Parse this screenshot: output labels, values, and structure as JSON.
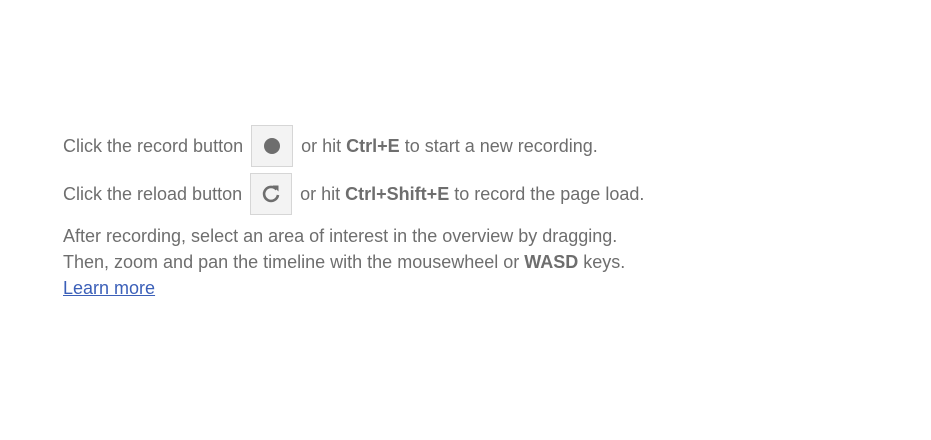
{
  "record_row": {
    "prefix": "Click the record button",
    "middle": "or hit",
    "key_1": "Ctrl",
    "plus_1": "+",
    "key_2": "E",
    "suffix": "to start a new recording.",
    "button_icon": "record-dot-icon"
  },
  "reload_row": {
    "prefix": "Click the reload button",
    "middle": "or hit",
    "key_1": "Ctrl",
    "plus_1": "+",
    "key_2": "Shift",
    "plus_2": "+",
    "key_3": "E",
    "suffix": "to record the page load.",
    "button_icon": "reload-icon"
  },
  "instructions": {
    "line_1": "After recording, select an area of interest in the overview by dragging.",
    "line_2_prefix": "Then, zoom and pan the timeline with the mousewheel or",
    "line_2_key": "WASD",
    "line_2_suffix": "keys.",
    "learn_more": "Learn more"
  },
  "colors": {
    "text": "#6e6e6e",
    "link": "#3b5fb8",
    "button_bg": "#f3f3f3",
    "button_border": "#d6d6d6"
  }
}
